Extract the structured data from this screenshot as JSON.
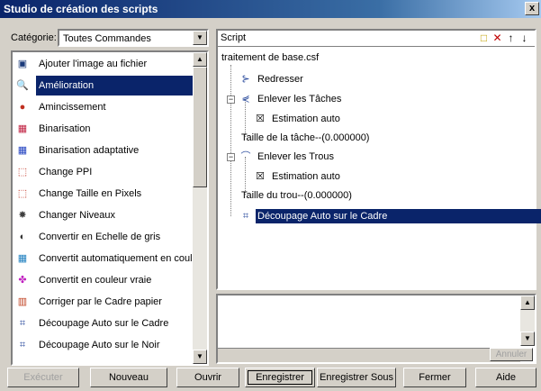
{
  "window": {
    "title": "Studio de création des scripts",
    "close_glyph": "x"
  },
  "category": {
    "label": "Catégorie:",
    "value": "Toutes Commandes"
  },
  "commands": [
    {
      "label": "Ajouter l'image au fichier",
      "icon": "add-image-icon",
      "glyph": "▣",
      "color": "#1a3a7a"
    },
    {
      "label": "Amélioration",
      "icon": "magnifier-icon",
      "glyph": "🔍",
      "color": "#555555",
      "selected": true
    },
    {
      "label": "Amincissement",
      "icon": "person-icon",
      "glyph": "●",
      "color": "#c03020"
    },
    {
      "label": "Binarisation",
      "icon": "binarize-icon",
      "glyph": "▦",
      "color": "#c02040"
    },
    {
      "label": "Binarisation adaptative",
      "icon": "adaptive-binarize-icon",
      "glyph": "▦",
      "color": "#2040c0"
    },
    {
      "label": "Change PPI",
      "icon": "ppi-icon",
      "glyph": "⬚",
      "color": "#c03020"
    },
    {
      "label": "Change Taille en Pixels",
      "icon": "resize-icon",
      "glyph": "⬚",
      "color": "#c03020"
    },
    {
      "label": "Changer Niveaux",
      "icon": "levels-icon",
      "glyph": "✸",
      "color": "#404040"
    },
    {
      "label": "Convertir en Echelle de gris",
      "icon": "grayscale-icon",
      "glyph": "◐",
      "color": "#303030"
    },
    {
      "label": "Convertit automatiquement en couleur",
      "icon": "auto-color-icon",
      "glyph": "▦",
      "color": "#2080c0"
    },
    {
      "label": "Convertit en couleur vraie",
      "icon": "true-color-icon",
      "glyph": "✤",
      "color": "#c020c0"
    },
    {
      "label": "Corriger par le Cadre papier",
      "icon": "frame-correct-icon",
      "glyph": "▥",
      "color": "#c04020"
    },
    {
      "label": "Découpage Auto sur le Cadre",
      "icon": "auto-crop-frame-icon",
      "glyph": "⌗",
      "color": "#3050a0"
    },
    {
      "label": "Découpage Auto sur le Noir",
      "icon": "auto-crop-black-icon",
      "glyph": "⌗",
      "color": "#3050a0"
    }
  ],
  "script": {
    "header": "Script",
    "header_icons": [
      "new-icon",
      "delete-icon",
      "move-up-icon",
      "move-down-icon"
    ],
    "header_glyphs": [
      "□",
      "✕",
      "↑",
      "↓"
    ],
    "root": "traitement de base.csf",
    "nodes": [
      {
        "label": "Redresser",
        "icon": "deskew-icon",
        "glyph": "⊱"
      },
      {
        "label": "Enlever les Tâches",
        "icon": "despeckle-icon",
        "glyph": "⋞"
      },
      {
        "label": "Estimation auto",
        "icon": "checkbox-checked-icon",
        "glyph": "☒"
      },
      {
        "label": "Taille de la tâche--(0.000000)",
        "icon": "",
        "glyph": ""
      },
      {
        "label": "Enlever les Trous",
        "icon": "hole-remove-icon",
        "glyph": "⌒"
      },
      {
        "label": "Estimation auto",
        "icon": "checkbox-checked-icon",
        "glyph": "☒"
      },
      {
        "label": "Taille du trou--(0.000000)",
        "icon": "",
        "glyph": ""
      },
      {
        "label": "Découpage Auto sur le Cadre",
        "icon": "auto-crop-frame-icon",
        "glyph": "⌗",
        "selected": true
      }
    ]
  },
  "apply_label": "Annuler",
  "buttons": {
    "execute": "Exécuter",
    "new": "Nouveau",
    "open": "Ouvrir",
    "save": "Enregistrer",
    "save_as": "Enregistrer Sous",
    "close": "Fermer",
    "help": "Aide"
  }
}
